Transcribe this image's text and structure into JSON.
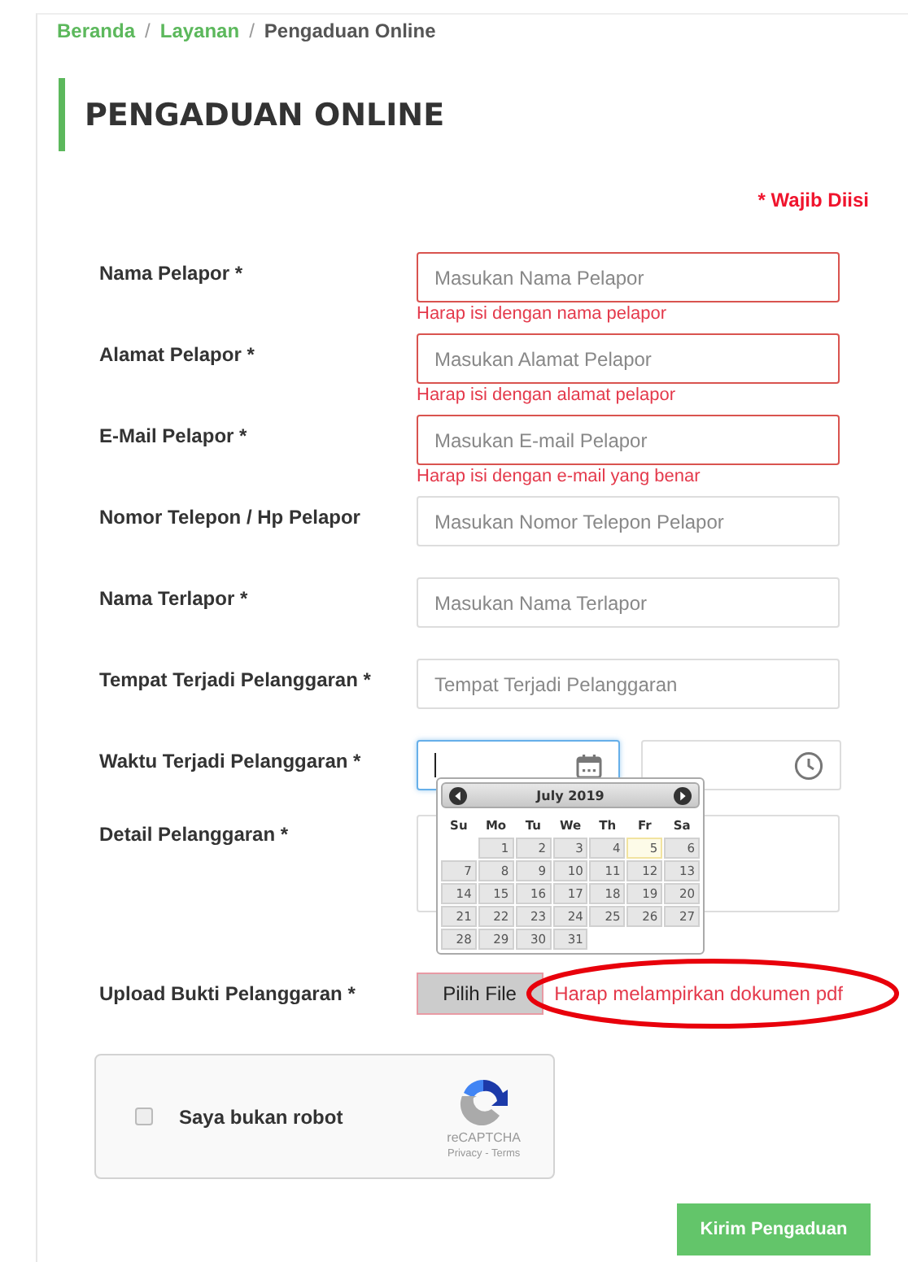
{
  "breadcrumb_separator": "/",
  "breadcrumb": [
    {
      "label": "Beranda",
      "kind": "link"
    },
    {
      "label": "Layanan",
      "kind": "link"
    },
    {
      "label": "Pengaduan Online",
      "kind": "current"
    }
  ],
  "title": "PENGADUAN ONLINE",
  "required_note": "* Wajib Diisi",
  "fields": [
    {
      "kind": "text",
      "label": "Nama Pelapor *",
      "placeholder": "Masukan Nama Pelapor",
      "error": "Harap isi dengan nama pelapor"
    },
    {
      "kind": "text",
      "label": "Alamat Pelapor *",
      "placeholder": "Masukan Alamat Pelapor",
      "error": "Harap isi dengan alamat pelapor"
    },
    {
      "kind": "text",
      "label": "E-Mail Pelapor *",
      "placeholder": "Masukan E-mail Pelapor",
      "error": "Harap isi dengan e-mail yang benar"
    },
    {
      "kind": "text",
      "label": "Nomor Telepon / Hp Pelapor",
      "placeholder": "Masukan Nomor Telepon Pelapor"
    },
    {
      "kind": "text",
      "label": "Nama Terlapor *",
      "placeholder": "Masukan Nama Terlapor"
    },
    {
      "kind": "text",
      "label": "Tempat Terjadi Pelanggaran *",
      "placeholder": "Tempat Terjadi Pelanggaran"
    },
    {
      "kind": "datetime",
      "label": "Waktu Terjadi Pelanggaran *",
      "focused": true
    },
    {
      "kind": "textarea",
      "label": "Detail Pelanggaran *"
    },
    {
      "kind": "file",
      "label": "Upload Bukti Pelanggaran *",
      "button": "Pilih File",
      "note": "Harap melampirkan dokumen pdf",
      "circled": true
    }
  ],
  "calendar": {
    "month": "July 2019",
    "weekdays": [
      "Su",
      "Mo",
      "Tu",
      "We",
      "Th",
      "Fr",
      "Sa"
    ],
    "weeks": [
      [
        {
          "kind": "blank"
        },
        {
          "day": "1",
          "today": false
        },
        {
          "day": "2",
          "today": false
        },
        {
          "day": "3",
          "today": false
        },
        {
          "day": "4",
          "today": false
        },
        {
          "day": "5",
          "today": true
        },
        {
          "day": "6",
          "today": false
        }
      ],
      [
        {
          "day": "7",
          "today": false
        },
        {
          "day": "8",
          "today": false
        },
        {
          "day": "9",
          "today": false
        },
        {
          "day": "10",
          "today": false
        },
        {
          "day": "11",
          "today": false
        },
        {
          "day": "12",
          "today": false
        },
        {
          "day": "13",
          "today": false
        }
      ],
      [
        {
          "day": "14",
          "today": false
        },
        {
          "day": "15",
          "today": false
        },
        {
          "day": "16",
          "today": false
        },
        {
          "day": "17",
          "today": false
        },
        {
          "day": "18",
          "today": false
        },
        {
          "day": "19",
          "today": false
        },
        {
          "day": "20",
          "today": false
        }
      ],
      [
        {
          "day": "21",
          "today": false
        },
        {
          "day": "22",
          "today": false
        },
        {
          "day": "23",
          "today": false
        },
        {
          "day": "24",
          "today": false
        },
        {
          "day": "25",
          "today": false
        },
        {
          "day": "26",
          "today": false
        },
        {
          "day": "27",
          "today": false
        }
      ],
      [
        {
          "day": "28",
          "today": false
        },
        {
          "day": "29",
          "today": false
        },
        {
          "day": "30",
          "today": false
        },
        {
          "day": "31",
          "today": false
        }
      ]
    ]
  },
  "captcha": {
    "label": "Saya bukan robot",
    "checked": false,
    "brand": "reCAPTCHA",
    "links": "Privacy - Terms"
  },
  "submit": "Kirim Pengaduan"
}
